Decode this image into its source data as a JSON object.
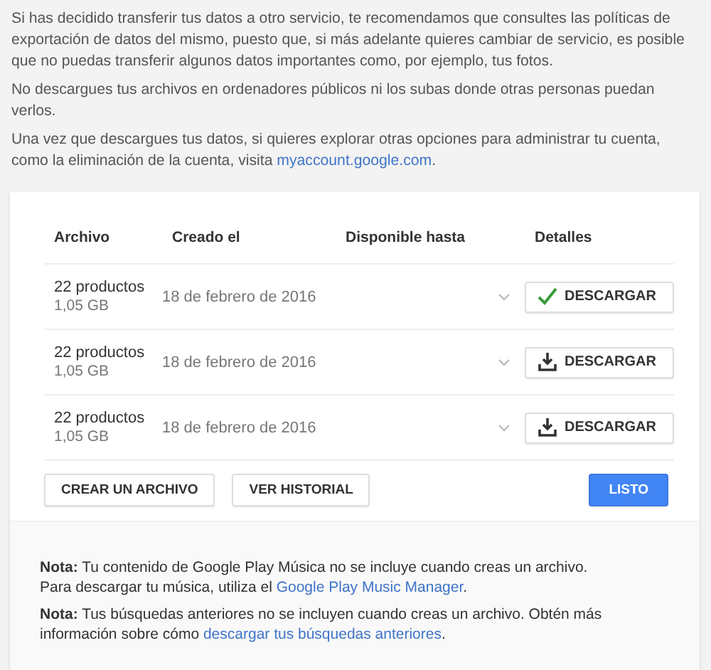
{
  "intro": [
    {
      "text": "Si has decidido transferir tus datos a otro servicio, te recomendamos que consultes las políticas de exportación de datos del mismo, puesto que, si más adelante quieres cambiar de servicio, es posible que no puedas transferir algunos datos importantes como, por ejemplo, tus fotos."
    },
    {
      "text": "No descargues tus archivos en ordenadores públicos ni los subas donde otras personas puedan verlos."
    },
    {
      "text": "Una vez que descargues tus datos, si quieres explorar otras opciones para administrar tu cuenta, como la eliminación de la cuenta, visita ",
      "link": "myaccount.google.com",
      "after": "."
    }
  ],
  "table": {
    "columns": [
      "Archivo",
      "Creado el",
      "Disponible hasta",
      "Detalles"
    ],
    "rows": [
      {
        "products": "22 productos",
        "size": "1,05 GB",
        "created": "18 de febrero de 2016",
        "button": {
          "label": "DESCARGAR",
          "kind": "downloaded"
        }
      },
      {
        "products": "22 productos",
        "size": "1,05 GB",
        "created": "18 de febrero de 2016",
        "button": {
          "label": "DESCARGAR",
          "kind": "download"
        }
      },
      {
        "products": "22 productos",
        "size": "1,05 GB",
        "created": "18 de febrero de 2016",
        "button": {
          "label": "DESCARGAR",
          "kind": "download"
        }
      }
    ]
  },
  "actions": [
    {
      "label": "CREAR UN ARCHIVO",
      "kind": "secondary"
    },
    {
      "label": "VER HISTORIAL",
      "kind": "secondary"
    },
    {
      "label": "LISTO",
      "kind": "primary"
    }
  ],
  "notes": [
    {
      "text": "**Nota:** Tu contenido de Google Play Música no se incluye cuando creas un archivo. Para descargar tu música, utiliza el ",
      "link": "Google Play Music Manager",
      "after": "."
    },
    {
      "text": "**Nota:** Tus búsquedas anteriores no se incluyen cuando creas un archivo. Obtén más información sobre cómo ",
      "link": "descargar tus búsquedas anteriores",
      "after": "."
    }
  ]
}
